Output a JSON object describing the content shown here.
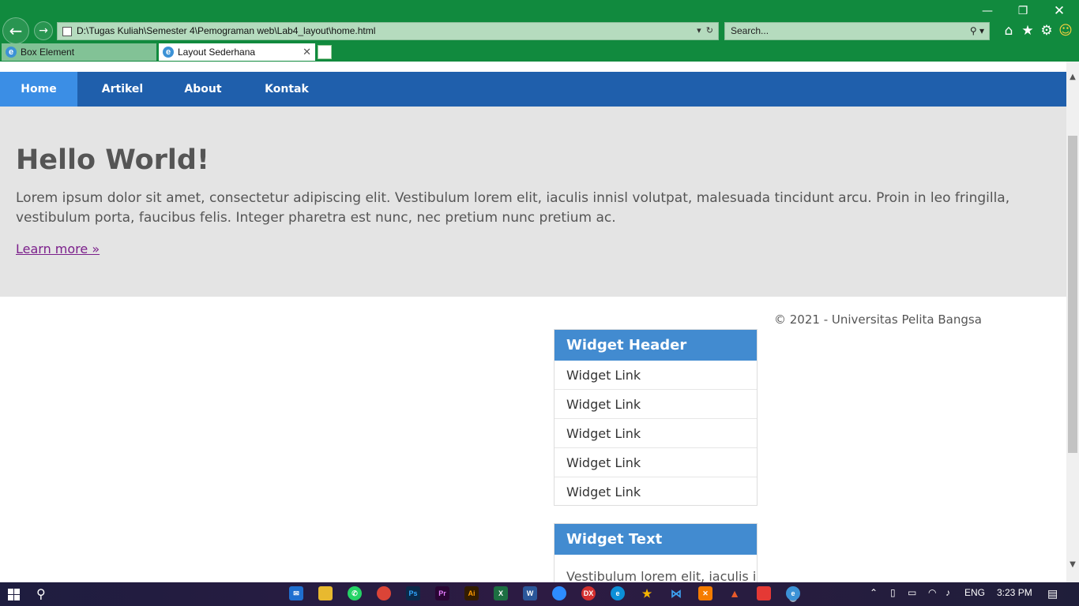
{
  "browser": {
    "address": "D:\\Tugas Kuliah\\Semester 4\\Pemograman web\\Lab4_layout\\home.html",
    "search_placeholder": "Search...",
    "tabs": [
      {
        "label": "Box Element"
      },
      {
        "label": "Layout Sederhana"
      }
    ]
  },
  "nav": {
    "items": [
      {
        "label": "Home",
        "active": true
      },
      {
        "label": "Artikel"
      },
      {
        "label": "About"
      },
      {
        "label": "Kontak"
      }
    ]
  },
  "hero": {
    "title": "Hello World!",
    "text": "Lorem ipsum dolor sit amet, consectetur adipiscing elit. Vestibulum lorem elit, iaculis innisl volutpat, malesuada tincidunt arcu. Proin in leo fringilla, vestibulum porta, faucibus felis. Integer pharetra est nunc, nec pretium nunc pretium ac.",
    "link": "Learn more »"
  },
  "footer": {
    "text": "© 2021 - Universitas Pelita Bangsa"
  },
  "widgets": {
    "links_header": "Widget Header",
    "links": [
      "Widget Link",
      "Widget Link",
      "Widget Link",
      "Widget Link",
      "Widget Link"
    ],
    "text_header": "Widget Text",
    "text_body": "Vestibulum lorem elit, iaculis in"
  },
  "taskbar": {
    "lang": "ENG",
    "time": "3:23 PM"
  },
  "colors": {
    "chrome": "#118a3e",
    "nav": "#1f5fac",
    "nav_active": "#3b8ee5",
    "widget_header": "#428bd0",
    "hero_bg": "#e4e4e4"
  }
}
